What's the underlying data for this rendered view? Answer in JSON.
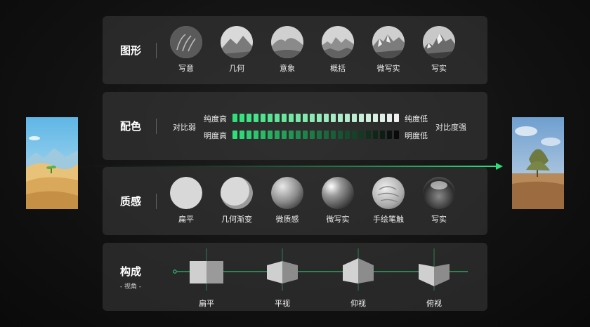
{
  "sections": {
    "shape": {
      "title": "图形",
      "items": [
        "写意",
        "几何",
        "意象",
        "概括",
        "微写实",
        "写实"
      ]
    },
    "color": {
      "title": "配色",
      "left_label": "对比弱",
      "right_label": "对比度强",
      "row1_left": "纯度高",
      "row1_right": "纯度低",
      "row2_left": "明度高",
      "row2_right": "明度低",
      "accent": "#2ee07a"
    },
    "texture": {
      "title": "质感",
      "items": [
        "扁平",
        "几何渐变",
        "微质感",
        "微写实",
        "手绘笔触",
        "写实"
      ]
    },
    "composition": {
      "title": "构成",
      "subtitle": "- 视角 -",
      "items": [
        "扁平",
        "平视",
        "仰视",
        "俯视"
      ]
    }
  }
}
